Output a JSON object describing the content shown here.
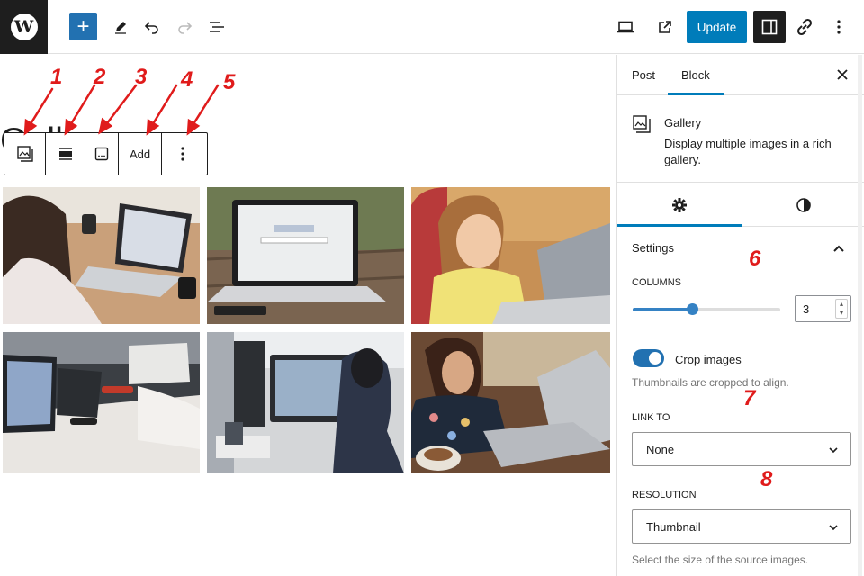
{
  "toolbar": {
    "add_label": "+",
    "update_label": "Update"
  },
  "editor": {
    "title_visible": "Gallery",
    "block_toolbar": {
      "add_label": "Add"
    }
  },
  "annotations": [
    "1",
    "2",
    "3",
    "4",
    "5",
    "6",
    "7",
    "8"
  ],
  "sidebar": {
    "tabs": [
      {
        "label": "Post"
      },
      {
        "label": "Block",
        "active": true
      }
    ],
    "block_card": {
      "name": "Gallery",
      "description": "Display multiple images in a rich gallery."
    },
    "settings_title": "Settings",
    "columns": {
      "label": "COLUMNS",
      "value": "3",
      "slider_fraction": 0.4
    },
    "crop": {
      "label": "Crop images",
      "help": "Thumbnails are cropped to align.",
      "enabled": true
    },
    "link_to": {
      "label": "LINK TO",
      "selected": "None"
    },
    "resolution": {
      "label": "RESOLUTION",
      "selected": "Thumbnail",
      "help": "Select the size of the source images."
    }
  },
  "colors": {
    "accent": "#007cba",
    "annotation": "#e01b1b",
    "dark": "#1e1e1e"
  }
}
